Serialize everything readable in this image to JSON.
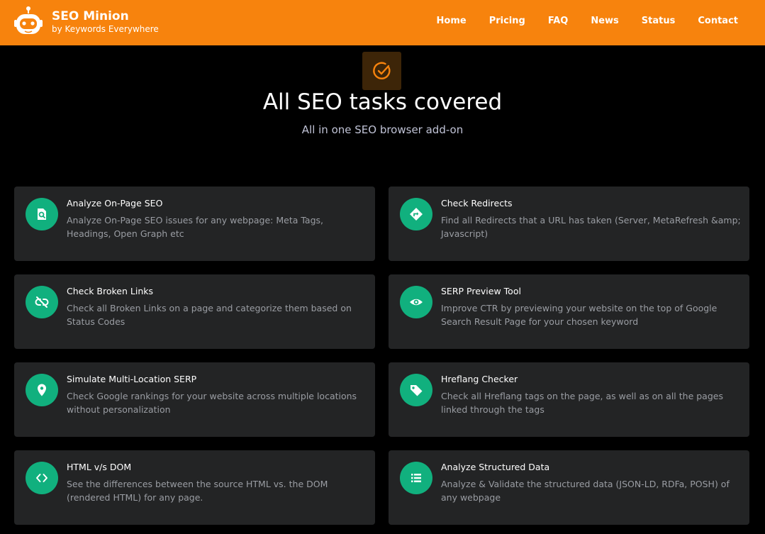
{
  "brand": {
    "title": "SEO Minion",
    "subtitle": "by Keywords Everywhere",
    "logo_icon": "robot-logo-icon"
  },
  "nav": {
    "items": [
      {
        "label": "Home"
      },
      {
        "label": "Pricing"
      },
      {
        "label": "FAQ"
      },
      {
        "label": "News"
      },
      {
        "label": "Status"
      },
      {
        "label": "Contact"
      }
    ]
  },
  "hero": {
    "icon": "check-circle-icon",
    "title": "All SEO tasks covered",
    "subtitle": "All in one SEO browser add-on"
  },
  "features": [
    {
      "icon": "search-document-icon",
      "title": "Analyze On-Page SEO",
      "desc": "Analyze On-Page SEO issues for any webpage: Meta Tags, Headings, Open Graph etc"
    },
    {
      "icon": "redirect-sign-icon",
      "title": "Check Redirects",
      "desc": "Find all Redirects that a URL has taken (Server, MetaRefresh &amp; Javascript)"
    },
    {
      "icon": "broken-link-icon",
      "title": "Check Broken Links",
      "desc": "Check all Broken Links on a page and categorize them based on Status Codes"
    },
    {
      "icon": "eye-icon",
      "title": "SERP Preview Tool",
      "desc": "Improve CTR by previewing your website on the top of Google Search Result Page for your chosen keyword"
    },
    {
      "icon": "location-pin-icon",
      "title": "Simulate Multi-Location SERP",
      "desc": "Check Google rankings for your website across multiple locations without personalization"
    },
    {
      "icon": "tag-icon",
      "title": "Hreflang Checker",
      "desc": "Check all Hreflang tags on the page, as well as on all the pages linked through the tags"
    },
    {
      "icon": "code-brackets-icon",
      "title": "HTML v/s DOM",
      "desc": "See the differences between the source HTML vs. the DOM (rendered HTML) for any page."
    },
    {
      "icon": "list-icon",
      "title": "Analyze Structured Data",
      "desc": "Analyze & Validate the structured data (JSON-LD, RDFa, POSH) of any webpage"
    }
  ],
  "colors": {
    "header": "#f7830d",
    "background": "#000000",
    "card": "#232425",
    "accent_green": "#11b07e",
    "hero_icon": "#f7830d"
  }
}
